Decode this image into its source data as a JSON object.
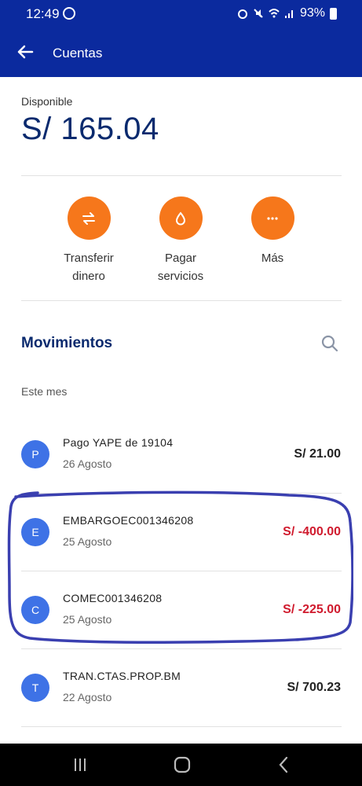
{
  "status_bar": {
    "time": "12:49",
    "battery": "93%"
  },
  "app_bar": {
    "title": "Cuentas"
  },
  "balance": {
    "label": "Disponible",
    "amount": "S/ 165.04"
  },
  "actions": [
    {
      "icon": "transfer-icon",
      "line1": "Transferir",
      "line2": "dinero"
    },
    {
      "icon": "drop-icon",
      "line1": "Pagar",
      "line2": "servicios"
    },
    {
      "icon": "more-icon",
      "line1": "Más",
      "line2": ""
    }
  ],
  "movements": {
    "title": "Movimientos",
    "month": "Este mes",
    "items": [
      {
        "initial": "P",
        "name": "Pago YAPE de 19104",
        "date": "26 Agosto",
        "amount": "S/ 21.00",
        "negative": false
      },
      {
        "initial": "E",
        "name": "EMBARGOEC001346208",
        "date": "25 Agosto",
        "amount": "S/ -400.00",
        "negative": true
      },
      {
        "initial": "C",
        "name": "COMEC001346208",
        "date": "25 Agosto",
        "amount": "S/ -225.00",
        "negative": true
      },
      {
        "initial": "T",
        "name": "TRAN.CTAS.PROP.BM",
        "date": "22 Agosto",
        "amount": "S/ 700.23",
        "negative": false
      }
    ]
  },
  "colors": {
    "header": "#0b2a9e",
    "accent": "#f6771b",
    "avatar": "#3e72e6",
    "negative": "#d01b2e",
    "annotation": "#3a3fb0"
  }
}
